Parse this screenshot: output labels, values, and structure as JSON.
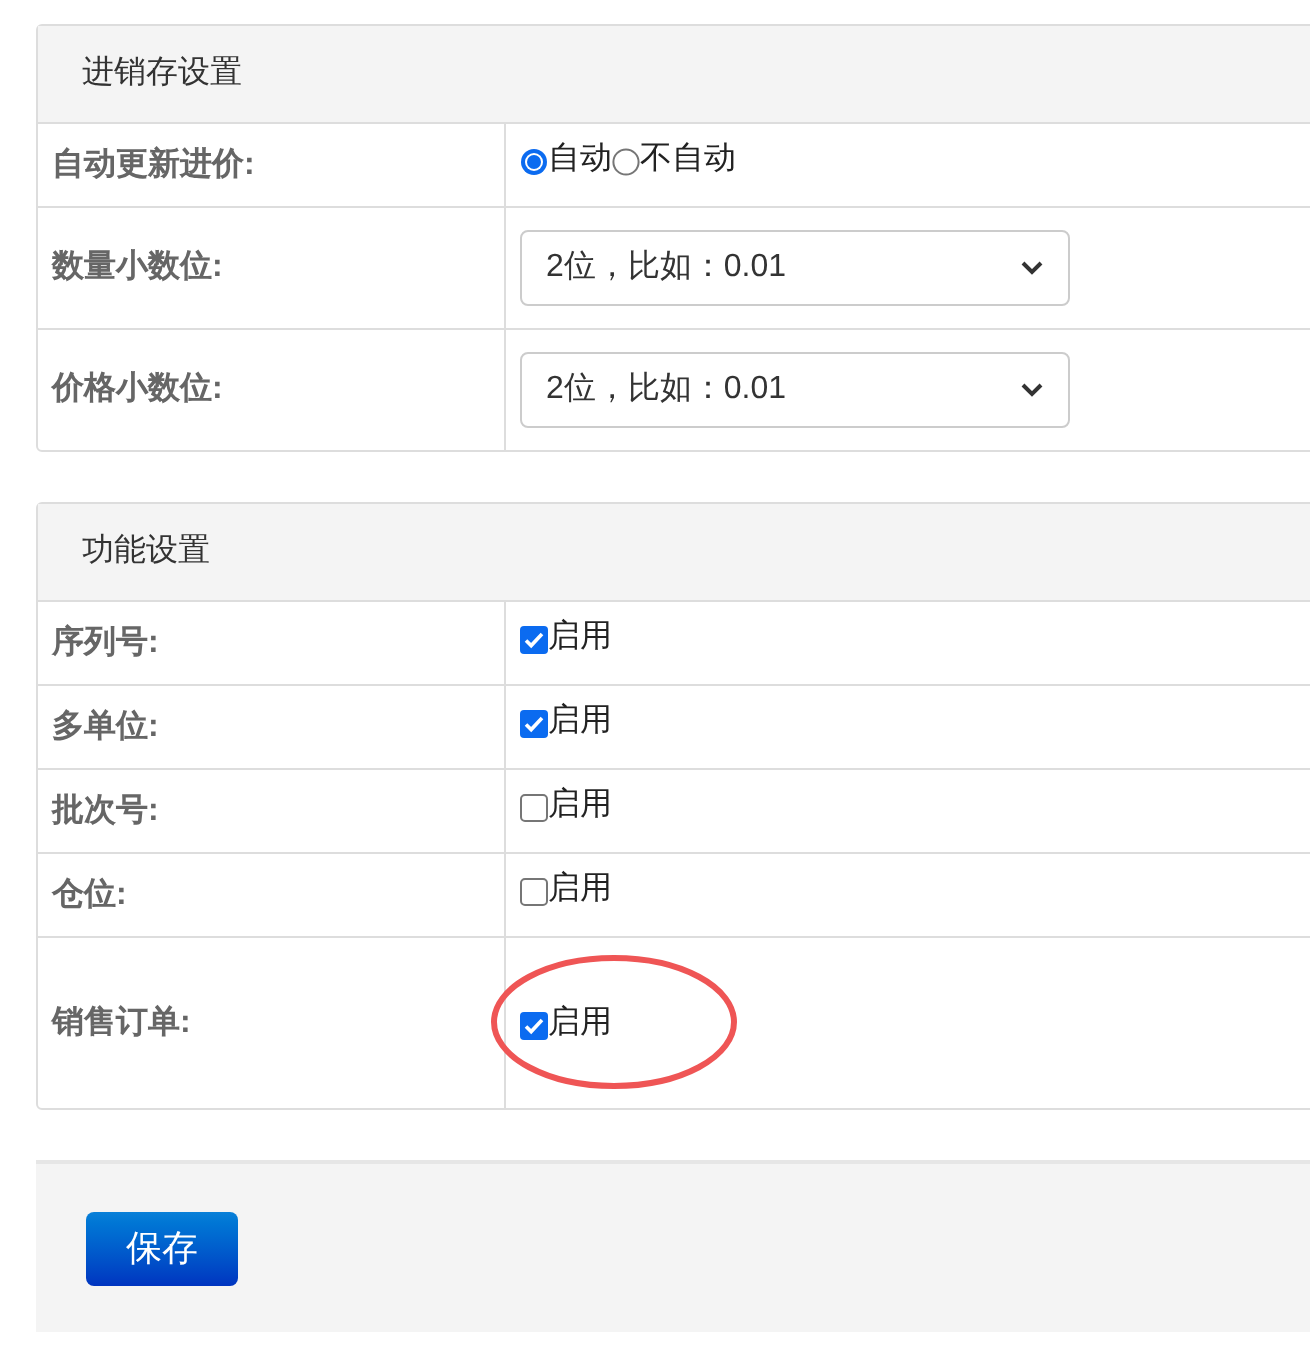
{
  "sections": [
    {
      "title": "进销存设置",
      "rows": [
        {
          "kind": "radio",
          "label": "自动更新进价:",
          "options": [
            {
              "label": "自动",
              "selected": true
            },
            {
              "label": "不自动",
              "selected": false
            }
          ]
        },
        {
          "kind": "select",
          "label": "数量小数位:",
          "value": "2位，比如：0.01"
        },
        {
          "kind": "select",
          "label": "价格小数位:",
          "value": "2位，比如：0.01"
        }
      ]
    },
    {
      "title": "功能设置",
      "rows": [
        {
          "kind": "checkbox",
          "label": "序列号:",
          "text": "启用",
          "checked": true,
          "highlighted": false
        },
        {
          "kind": "checkbox",
          "label": "多单位:",
          "text": "启用",
          "checked": true,
          "highlighted": false
        },
        {
          "kind": "checkbox",
          "label": "批次号:",
          "text": "启用",
          "checked": false,
          "highlighted": false
        },
        {
          "kind": "checkbox",
          "label": "仓位:",
          "text": "启用",
          "checked": false,
          "highlighted": false
        },
        {
          "kind": "checkbox",
          "label": "销售订单:",
          "text": "启用",
          "checked": true,
          "highlighted": true
        }
      ]
    }
  ],
  "save_button": "保存"
}
